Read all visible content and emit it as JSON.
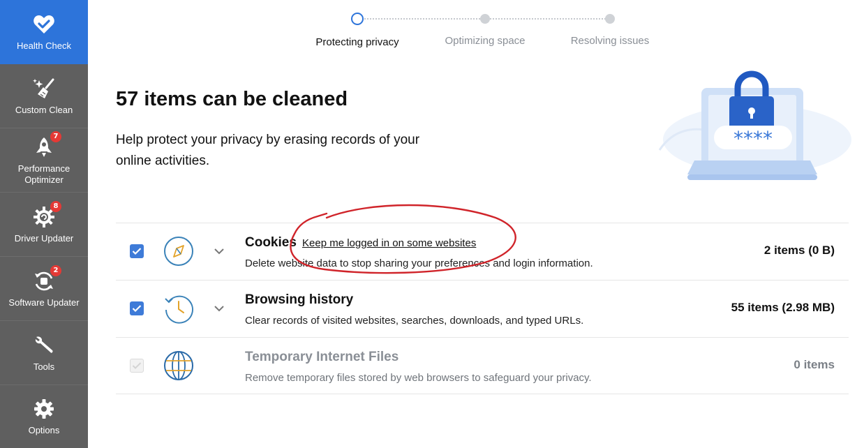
{
  "sidebar": {
    "items": [
      {
        "label": "Health Check",
        "icon": "heart-check-icon",
        "active": true
      },
      {
        "label": "Custom Clean",
        "icon": "broom-sparkle-icon"
      },
      {
        "label": "Performance Optimizer",
        "icon": "rocket-icon",
        "badge": "7"
      },
      {
        "label": "Driver Updater",
        "icon": "gear-chip-icon",
        "badge": "8"
      },
      {
        "label": "Software Updater",
        "icon": "refresh-box-icon",
        "badge": "2"
      },
      {
        "label": "Tools",
        "icon": "wrench-icon"
      },
      {
        "label": "Options",
        "icon": "gear-icon"
      }
    ]
  },
  "stepper": {
    "steps": [
      {
        "label": "Protecting privacy",
        "state": "current"
      },
      {
        "label": "Optimizing space",
        "state": "pending"
      },
      {
        "label": "Resolving issues",
        "state": "pending"
      }
    ]
  },
  "main": {
    "headline": "57 items can be cleaned",
    "subtext": "Help protect your privacy by erasing records of your online activities.",
    "illustration_text": "****"
  },
  "items": [
    {
      "title": "Cookies",
      "link": "Keep me logged in on some websites",
      "description": "Delete website data to stop sharing your preferences and login information.",
      "count": "2 items (0 B)",
      "checked": true,
      "icon": "compass-icon"
    },
    {
      "title": "Browsing history",
      "description": "Clear records of visited websites, searches, downloads, and typed URLs.",
      "count": "55 items (2.98 MB)",
      "checked": true,
      "icon": "history-clock-icon"
    },
    {
      "title": "Temporary Internet Files",
      "description": "Remove temporary files stored by web browsers to safeguard your privacy.",
      "count": "0 items",
      "checked": false,
      "disabled": true,
      "icon": "globe-icon"
    }
  ],
  "colors": {
    "accent": "#2d74da",
    "sidebar": "#5f5f5f",
    "badge": "#e53935",
    "annotation": "#d0242a"
  }
}
